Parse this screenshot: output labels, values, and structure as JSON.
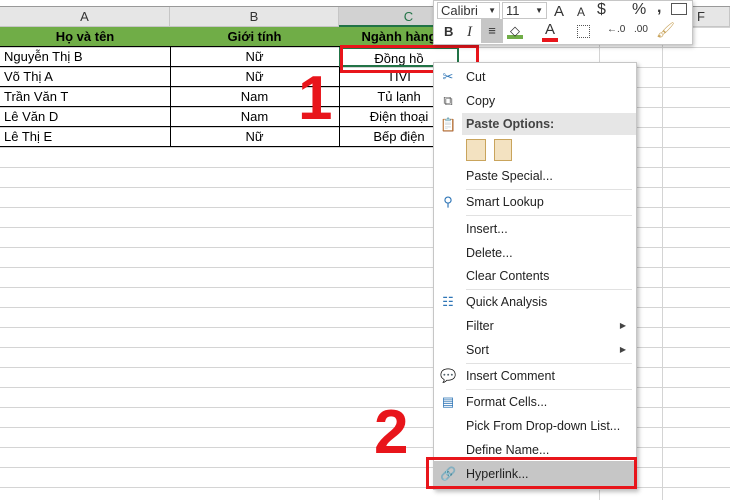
{
  "columns": [
    "A",
    "B",
    "C",
    "F"
  ],
  "table": {
    "headers": [
      "Họ và tên",
      "Giới tính",
      "Ngành hàng"
    ],
    "rows": [
      [
        "Nguyễn Thị B",
        "Nữ",
        "Đồng hồ"
      ],
      [
        "Võ Thị A",
        "Nữ",
        "TIVI"
      ],
      [
        "Trần Văn T",
        "Nam",
        "Tủ lạnh"
      ],
      [
        "Lê Văn D",
        "Nam",
        "Điện thoại"
      ],
      [
        "Lê Thị E",
        "Nữ",
        "Bếp điện"
      ]
    ]
  },
  "toolbar": {
    "font": "Calibri",
    "size": "11",
    "bold": "B",
    "italic": "I",
    "currency": "$",
    "percent": "%",
    "comma": ","
  },
  "menu": {
    "cut": "Cut",
    "copy": "Copy",
    "paste_options": "Paste Options:",
    "paste_special": "Paste Special...",
    "smart_lookup": "Smart Lookup",
    "insert": "Insert...",
    "delete": "Delete...",
    "clear_contents": "Clear Contents",
    "quick_analysis": "Quick Analysis",
    "filter": "Filter",
    "sort": "Sort",
    "insert_comment": "Insert Comment",
    "format_cells": "Format Cells...",
    "pick_list": "Pick From Drop-down List...",
    "define_name": "Define Name...",
    "hyperlink": "Hyperlink..."
  },
  "annotations": {
    "step1": "1",
    "step2": "2"
  },
  "colors": {
    "header_green": "#70ad47",
    "highlight_red": "#e8151b",
    "excel_green": "#217346"
  }
}
